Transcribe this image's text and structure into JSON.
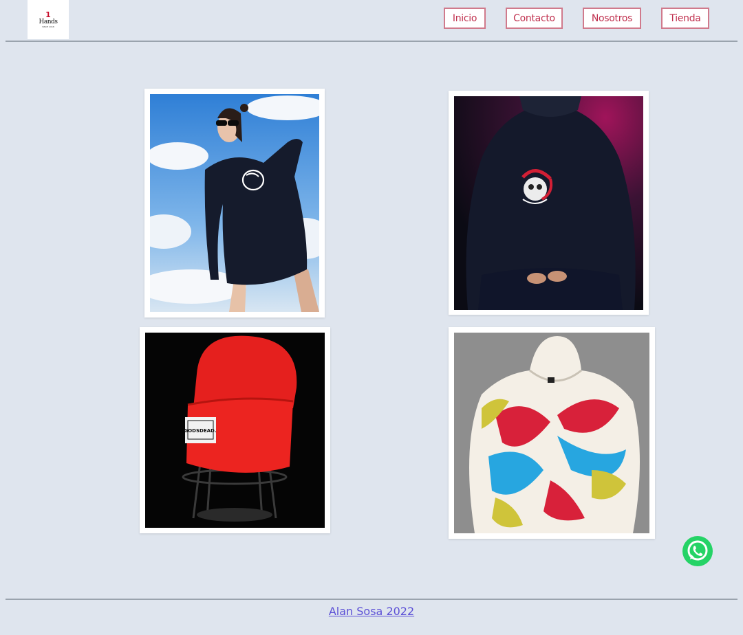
{
  "header": {
    "logo": {
      "number": "1",
      "brand": "Hands",
      "tagline": "SINCE 2018"
    },
    "nav": [
      {
        "label": "Inicio"
      },
      {
        "label": "Contacto"
      },
      {
        "label": "Nosotros"
      },
      {
        "label": "Tienda"
      }
    ]
  },
  "gallery": {
    "items": [
      {
        "alt": "woman in black hoodie with bear logo against sky",
        "logo_text": ""
      },
      {
        "alt": "man in navy hoodie with skull dragon print",
        "logo_text": ""
      },
      {
        "alt": "red beanie on stand",
        "logo_text": "GODSDEAD."
      },
      {
        "alt": "tie-dye hoodie red blue yellow",
        "logo_text": ""
      }
    ]
  },
  "footer": {
    "credit": "Alan Sosa 2022"
  },
  "floating": {
    "icon": "whatsapp-icon"
  },
  "colors": {
    "background": "#dfe5ee",
    "nav_border": "#d07a8c",
    "nav_text": "#c0304e",
    "link": "#5b4fd6",
    "whatsapp": "#25d366"
  }
}
